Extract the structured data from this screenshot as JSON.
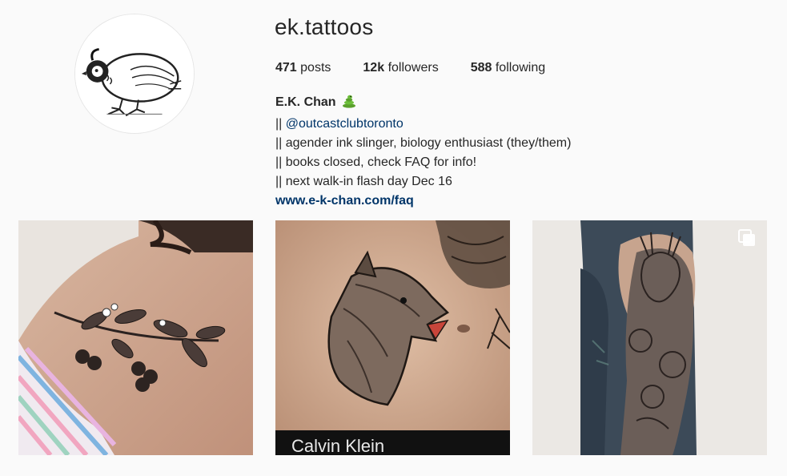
{
  "profile": {
    "username": "ek.tattoos",
    "avatar_alt": "quail drawing",
    "stats": {
      "posts_count": "471",
      "posts_label": "posts",
      "followers_count": "12k",
      "followers_label": "followers",
      "following_count": "588",
      "following_label": "following"
    },
    "bio": {
      "name": "E.K. Chan",
      "name_emoji": "snake-icon",
      "line1_prefix": "|| ",
      "line1_mention": "@outcastclubtoronto",
      "line2": "|| agender ink slinger, biology enthusiast (they/them)",
      "line3": "|| books closed, check FAQ for info!",
      "line4": "|| next walk-in flash day Dec 16",
      "website": "www.e-k-chan.com/faq"
    }
  },
  "posts": [
    {
      "subject": "cherry blossom branch shoulder tattoo",
      "icon": ""
    },
    {
      "subject": "hyena head stomach tattoo",
      "waistband_text": "Calvin Klein",
      "icon": ""
    },
    {
      "subject": "deer and flowers sleeve tattoo",
      "icon": "multiple-photos-icon"
    }
  ],
  "colors": {
    "link": "#003569",
    "text": "#262626",
    "background": "#fafafa"
  }
}
